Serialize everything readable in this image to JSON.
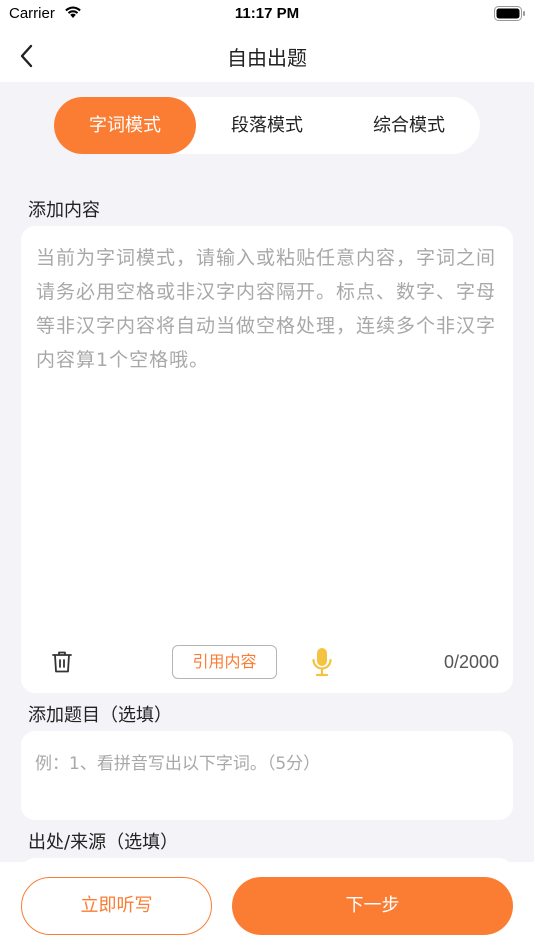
{
  "status_bar": {
    "carrier": "Carrier",
    "time": "11:17 PM",
    "icons": [
      "wifi-icon",
      "battery-icon"
    ]
  },
  "nav": {
    "title": "自由出题",
    "back_icon": "chevron-left-icon"
  },
  "mode_tabs": [
    {
      "label": "字词模式",
      "active": true
    },
    {
      "label": "段落模式",
      "active": false
    },
    {
      "label": "综合模式",
      "active": false
    }
  ],
  "content_section": {
    "label": "添加内容",
    "placeholder": "当前为字词模式，请输入或粘贴任意内容，字词之间请务必用空格或非汉字内容隔开。标点、数字、字母等非汉字内容将自动当做空格处理，连续多个非汉字内容算1个空格哦。",
    "quote_button": "引用内容",
    "char_count": "0/2000",
    "icons": [
      "trash-icon",
      "microphone-icon"
    ]
  },
  "title_section": {
    "label": "添加题目（选填）",
    "placeholder": "例：1、看拼音写出以下字词。（5分）"
  },
  "source_section": {
    "label": "出处/来源（选填）"
  },
  "actions": {
    "dictate_button": "立即听写",
    "next_button": "下一步"
  },
  "colors": {
    "accent": "#fb7d34",
    "background": "#f4f3f8",
    "placeholder": "#a8a8a8"
  }
}
